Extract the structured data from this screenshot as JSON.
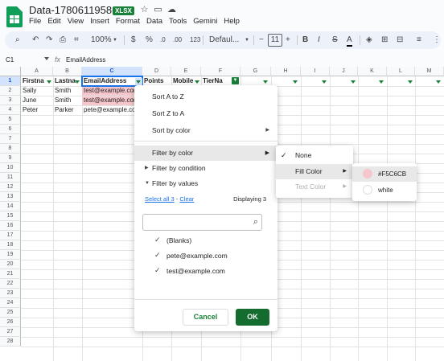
{
  "header": {
    "title": "Data-1780611958656",
    "badge": "XLSX",
    "menu": [
      "File",
      "Edit",
      "View",
      "Insert",
      "Format",
      "Data",
      "Tools",
      "Gemini",
      "Help"
    ]
  },
  "toolbar": {
    "zoom": "100%",
    "currency": "$",
    "percent": "%",
    "decrease_decimals": ".0",
    "increase_decimals": ".00",
    "number_format": "123",
    "font": "Defaul...",
    "font_size": "11",
    "bold": "B",
    "italic": "I",
    "text_color": "A"
  },
  "formula_bar": {
    "cell_ref": "C1",
    "fx": "fx",
    "value": "EmailAddress"
  },
  "columns": [
    "A",
    "B",
    "C",
    "D",
    "E",
    "F",
    "G",
    "H",
    "I",
    "J",
    "K",
    "L",
    "M"
  ],
  "rows": [
    "1",
    "2",
    "3",
    "4",
    "5",
    "6",
    "7",
    "8",
    "9",
    "10",
    "11",
    "12",
    "13",
    "14",
    "15",
    "16",
    "17",
    "18",
    "19",
    "20",
    "21",
    "22",
    "23",
    "24",
    "25",
    "26",
    "27",
    "28"
  ],
  "sheet": {
    "headers": [
      "Firstna",
      "Lastna",
      "EmailAddress",
      "Points",
      "Mobile",
      "TierNa"
    ],
    "data": [
      [
        "Sally",
        "Smith",
        "test@example.com"
      ],
      [
        "June",
        "Smith",
        "test@example.com"
      ],
      [
        "Peter",
        "Parker",
        "pete@example.com"
      ]
    ],
    "highlight_color": "#F5C6CB"
  },
  "filter_menu": {
    "sort_az": "Sort A to Z",
    "sort_za": "Sort Z to A",
    "sort_color": "Sort by color",
    "filter_color": "Filter by color",
    "filter_condition": "Filter by condition",
    "filter_values": "Filter by values",
    "select_all": "Select all 3",
    "separator": "-",
    "clear": "Clear",
    "displaying": "Displaying 3",
    "values": [
      "(Blanks)",
      "pete@example.com",
      "test@example.com"
    ],
    "cancel": "Cancel",
    "ok": "OK"
  },
  "color_submenu": {
    "none": "None",
    "fill_color": "Fill Color",
    "text_color": "Text Color"
  },
  "fill_submenu": {
    "options": [
      {
        "label": "#F5C6CB",
        "color": "#F5C6CB"
      },
      {
        "label": "white",
        "color": "#FFFFFF"
      }
    ]
  },
  "colors": {
    "accent": "#188038",
    "ok_button": "#146c2e",
    "link": "#1a73e8"
  }
}
